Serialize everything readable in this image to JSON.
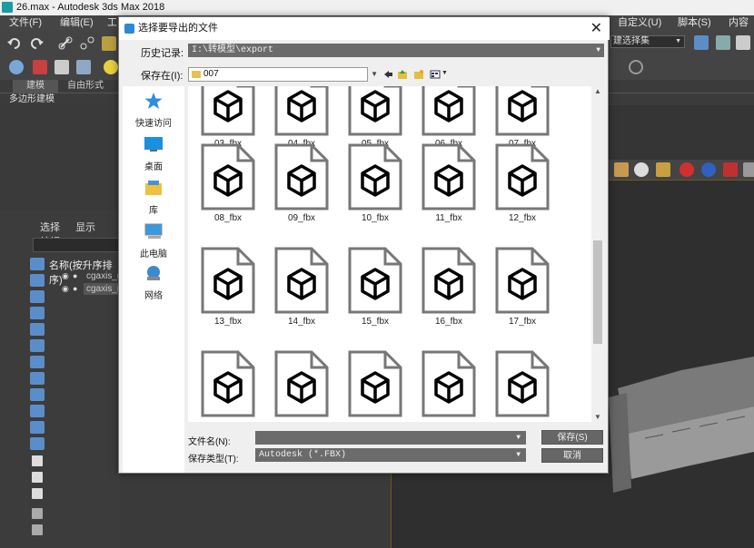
{
  "app": {
    "title": "26.max - Autodesk 3ds Max 2018"
  },
  "menubar": {
    "items": [
      "文件(F)",
      "编辑(E)",
      "工"
    ],
    "right_items": [
      "自定义(U)",
      "脚本(S)",
      "内容"
    ]
  },
  "toolbar": {
    "selection_set": "建选择集"
  },
  "ribbon": {
    "tabs": [
      "建模",
      "自由形式"
    ],
    "sub": "多边形建模"
  },
  "scene_explorer": {
    "tabs": [
      "选择",
      "显示",
      "编辑"
    ],
    "header": "名称(按升序排序)",
    "rows": [
      "cgaxis_m",
      "cgaxis_m"
    ]
  },
  "dialog": {
    "title": "选择要导出的文件",
    "history_label": "历史记录:",
    "history_value": "I:\\转模型\\export",
    "savein_label": "保存在(I):",
    "savein_value": "007",
    "places": [
      "快速访问",
      "桌面",
      "库",
      "此电脑",
      "网络"
    ],
    "files": [
      [
        "03_fbx",
        "04_fbx",
        "05_fbx",
        "06_fbx",
        "07_fbx"
      ],
      [
        "08_fbx",
        "09_fbx",
        "10_fbx",
        "11_fbx",
        "12_fbx"
      ],
      [
        "13_fbx",
        "14_fbx",
        "15_fbx",
        "16_fbx",
        "17_fbx"
      ],
      [
        "",
        "",
        "",
        "",
        ""
      ]
    ],
    "filename_label": "文件名(N):",
    "filename_value": "",
    "filetype_label": "保存类型(T):",
    "filetype_value": "Autodesk (*.FBX)",
    "save_button": "保存(S)",
    "cancel_button": "取消"
  }
}
